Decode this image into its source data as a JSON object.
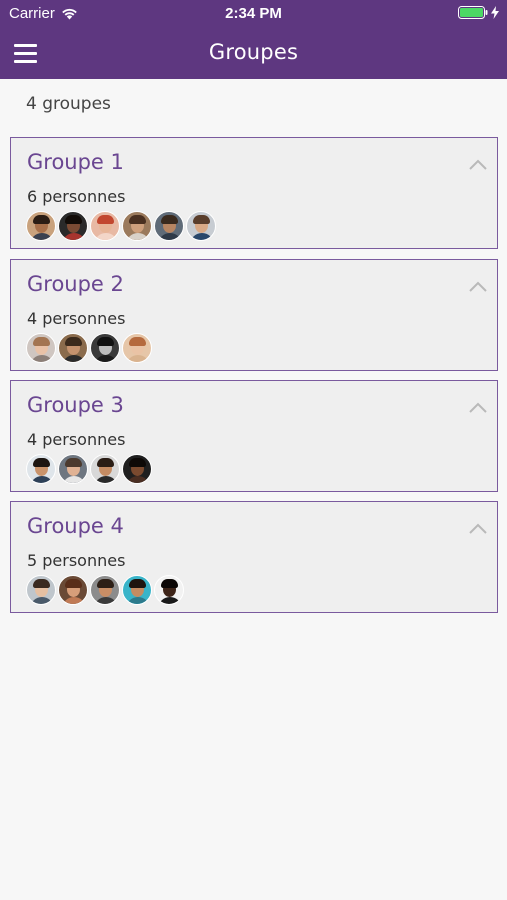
{
  "status": {
    "carrier": "Carrier",
    "time": "2:34 PM"
  },
  "nav": {
    "title": "Groupes"
  },
  "summary": "4 groupes",
  "groups": [
    {
      "title": "Groupe 1",
      "count_label": "6 personnes",
      "avatars": [
        {
          "bg": "#c9a27d",
          "skin": "#a8704a",
          "hair": "#2b1d14",
          "shirt": "#3a4150"
        },
        {
          "bg": "#2a2a2a",
          "skin": "#7b4b34",
          "hair": "#120c08",
          "shirt": "#a8342e"
        },
        {
          "bg": "#e8b9a4",
          "skin": "#e7b597",
          "hair": "#c2472f",
          "shirt": "#f3d6c8"
        },
        {
          "bg": "#9b7a5c",
          "skin": "#cfa07c",
          "hair": "#4a3020",
          "shirt": "#d8d1c8"
        },
        {
          "bg": "#5f6b78",
          "skin": "#b78562",
          "hair": "#3a2a1e",
          "shirt": "#2f3a48"
        },
        {
          "bg": "#c7ccd2",
          "skin": "#d9a986",
          "hair": "#5a3e2c",
          "shirt": "#29476b"
        }
      ]
    },
    {
      "title": "Groupe 2",
      "count_label": "4 personnes",
      "avatars": [
        {
          "bg": "#cfc6c1",
          "skin": "#e9c2a7",
          "hair": "#a37552",
          "shirt": "#8c7f78"
        },
        {
          "bg": "#8a6b4c",
          "skin": "#c4926e",
          "hair": "#3b2a1c",
          "shirt": "#2b2b2b"
        },
        {
          "bg": "#3a3a3a",
          "skin": "#bdbdbd",
          "hair": "#111111",
          "shirt": "#1c1c1c"
        },
        {
          "bg": "#e6c6a8",
          "skin": "#eac3a5",
          "hair": "#b56a3e",
          "shirt": "#d9b38f"
        }
      ]
    },
    {
      "title": "Groupe 3",
      "count_label": "4 personnes",
      "avatars": [
        {
          "bg": "#dfe5ea",
          "skin": "#c9936b",
          "hair": "#1d1612",
          "shirt": "#2e4158"
        },
        {
          "bg": "#6e7680",
          "skin": "#e0b294",
          "hair": "#4c3a2e",
          "shirt": "#e6e6e6"
        },
        {
          "bg": "#d8d8d8",
          "skin": "#c58c63",
          "hair": "#2a1d15",
          "shirt": "#2a2a2a"
        },
        {
          "bg": "#1f1f1f",
          "skin": "#7a4a2f",
          "hair": "#0d0907",
          "shirt": "#4a2e22"
        }
      ]
    },
    {
      "title": "Groupe 4",
      "count_label": "5 personnes",
      "avatars": [
        {
          "bg": "#bfc6cc",
          "skin": "#e6c0a2",
          "hair": "#3a2a20",
          "shirt": "#4a5a6a"
        },
        {
          "bg": "#6a4a36",
          "skin": "#d79e7a",
          "hair": "#5a2e1a",
          "shirt": "#c07a55"
        },
        {
          "bg": "#8c8c8c",
          "skin": "#c98e66",
          "hair": "#2d1f16",
          "shirt": "#3b3b3b"
        },
        {
          "bg": "#39b4c9",
          "skin": "#c48c62",
          "hair": "#1e150f",
          "shirt": "#2c7a8c"
        },
        {
          "bg": "#f2f2f2",
          "skin": "#3d2418",
          "hair": "#0c0806",
          "shirt": "#1a1a1a"
        }
      ]
    }
  ],
  "colors": {
    "header": "#5e3780",
    "accent": "#6a4691",
    "border": "#7a5a9e",
    "card": "#efefef",
    "background": "#f7f7f7",
    "battery": "#4cd964"
  },
  "icons": {
    "menu": "hamburger-menu-icon",
    "wifi": "wifi-icon",
    "battery": "battery-icon",
    "charging": "charging-bolt-icon",
    "chevron": "chevron-up-icon"
  }
}
